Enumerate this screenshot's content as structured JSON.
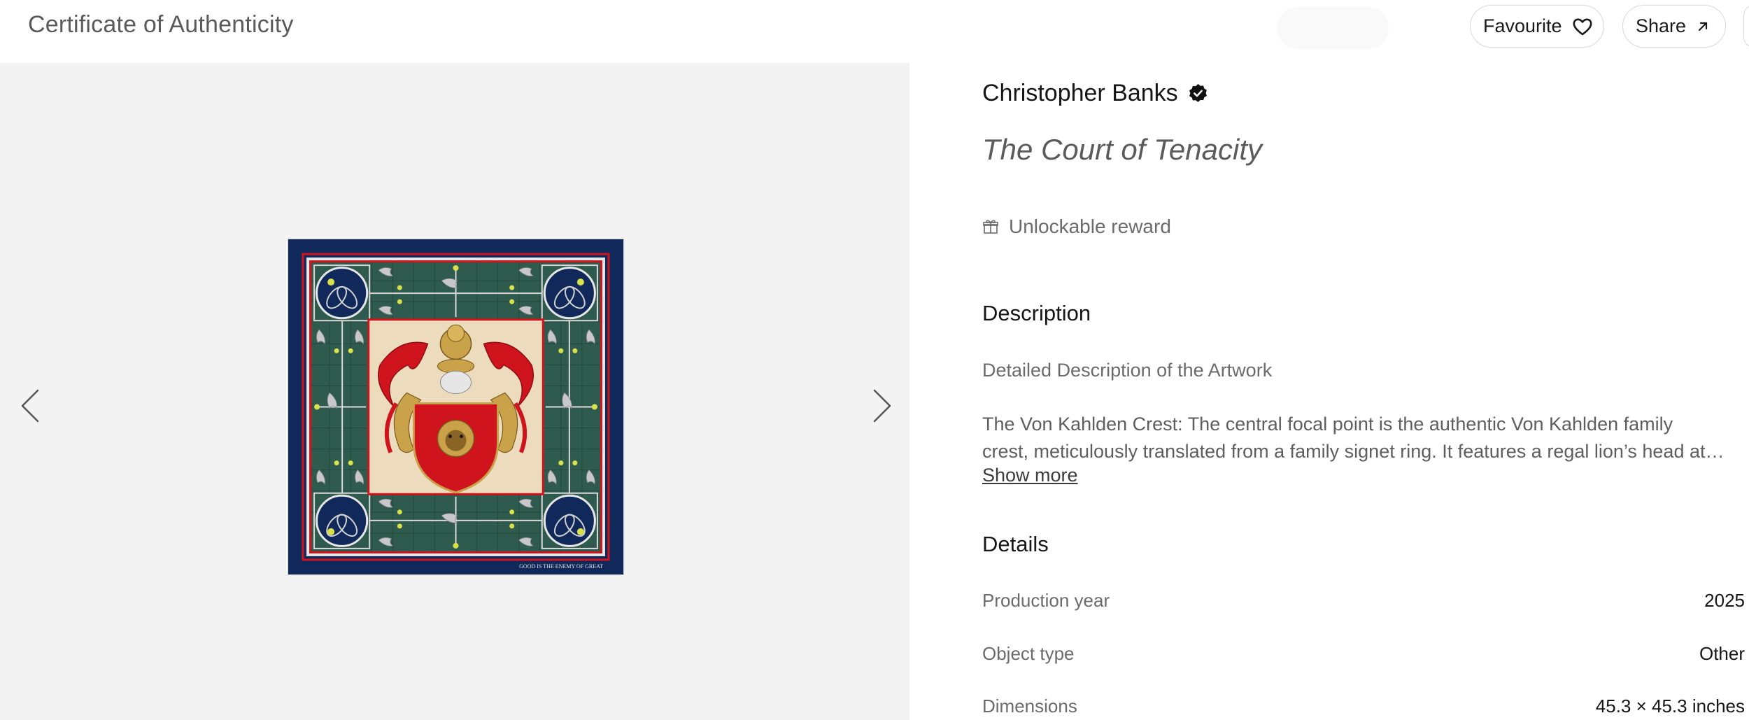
{
  "header": {
    "title": "Certificate of Authenticity",
    "favourite_label": "Favourite",
    "share_label": "Share"
  },
  "gallery": {
    "prev_icon": "chevron-left-icon",
    "next_icon": "chevron-right-icon",
    "artwork_motto": "GOOD IS THE ENEMY OF GREAT"
  },
  "artwork": {
    "artist": "Christopher Banks",
    "verified_icon": "verified-check-icon",
    "title": "The Court of Tenacity",
    "reward_icon": "gift-icon",
    "reward_label": "Unlockable reward"
  },
  "description": {
    "heading": "Description",
    "subheading": "Detailed Description of the Artwork",
    "line1": "The Von Kahlden Crest: The central focal point is the authentic Von Kahlden family",
    "line2": "crest, meticulously translated from a family signet ring. It features a regal lion’s head at…",
    "show_more": "Show more"
  },
  "details": {
    "heading": "Details",
    "rows": [
      {
        "label": "Production year",
        "value": "2025"
      },
      {
        "label": "Object type",
        "value": "Other"
      },
      {
        "label": "Dimensions",
        "value": "45.3 × 45.3 inches"
      }
    ]
  },
  "colors": {
    "navy": "#10295a",
    "green": "#2f5a4e",
    "red": "#d0141d",
    "gold": "#c9a24a",
    "cream": "#ecdcbd",
    "panel_bg": "#f3f3f3"
  }
}
